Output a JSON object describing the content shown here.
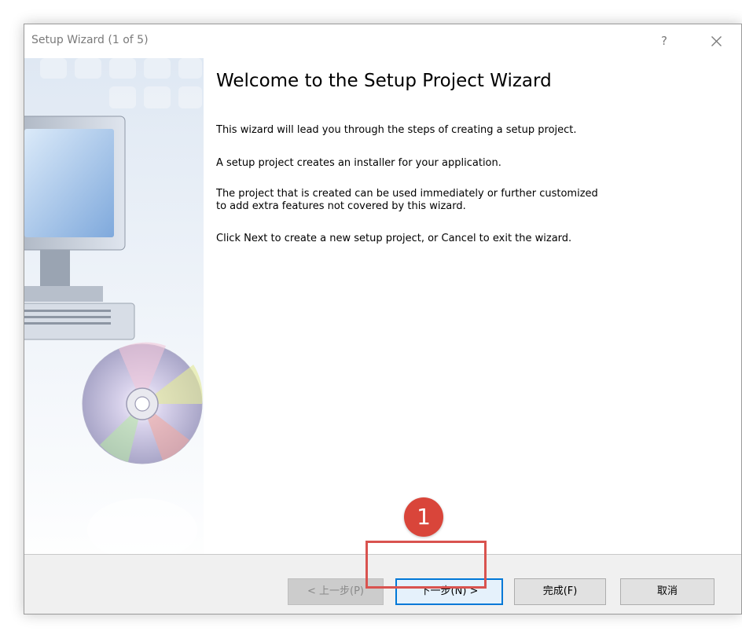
{
  "window": {
    "title": "Setup Wizard (1 of 5)",
    "help_label": "?"
  },
  "sidebar": {
    "graphic": "computer-and-cd-illustration"
  },
  "content": {
    "heading": "Welcome to the Setup Project Wizard",
    "paragraphs": [
      "This wizard will lead you through the steps of creating a setup project.",
      "A setup project creates an installer for your application.",
      "The project that is created can be used immediately or further customized",
      "to add extra features not covered by this wizard.",
      "Click Next to create a new setup project, or Cancel to exit the wizard."
    ]
  },
  "buttons": {
    "back": "< 上一步(P)",
    "next": "下一步(N) >",
    "finish": "完成(F)",
    "cancel": "取消"
  },
  "annotation": {
    "step_number": "1",
    "color": "#d9453a"
  },
  "colors": {
    "accent": "#0078d7",
    "highlight": "#d9534f"
  }
}
